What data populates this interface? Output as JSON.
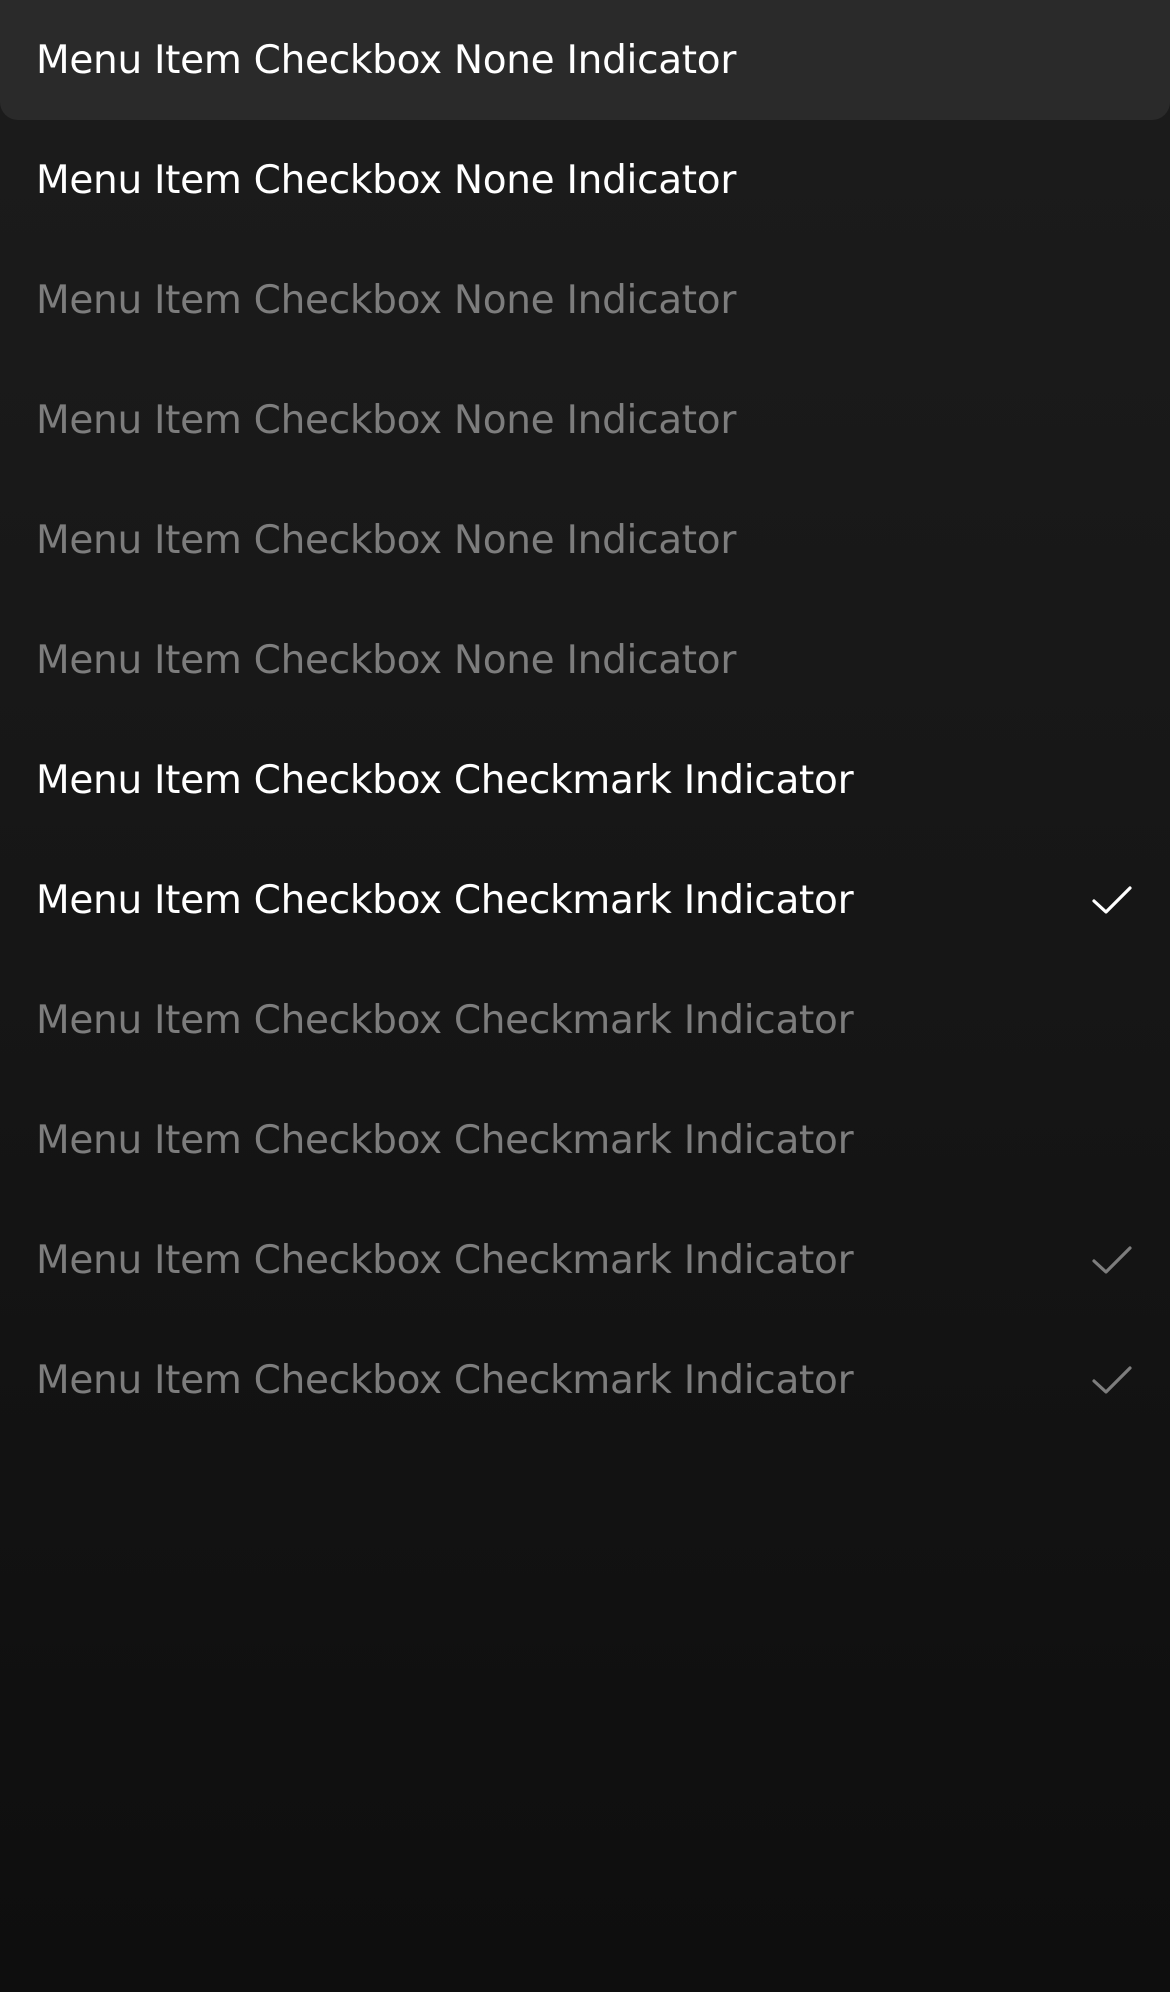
{
  "colors": {
    "background": "#1a1a1a",
    "highlight": "#2a2a2a",
    "text_primary": "#ffffff",
    "text_muted": "#7d7d7d"
  },
  "menu": {
    "items": [
      {
        "label": "Menu Item Checkbox None Indicator",
        "style": "primary",
        "highlighted": true,
        "checked": false,
        "icon": ""
      },
      {
        "label": "Menu Item Checkbox None Indicator",
        "style": "primary",
        "highlighted": false,
        "checked": false,
        "icon": ""
      },
      {
        "label": "Menu Item Checkbox None Indicator",
        "style": "muted",
        "highlighted": false,
        "checked": false,
        "icon": ""
      },
      {
        "label": "Menu Item Checkbox None Indicator",
        "style": "muted",
        "highlighted": false,
        "checked": false,
        "icon": ""
      },
      {
        "label": "Menu Item Checkbox None Indicator",
        "style": "muted",
        "highlighted": false,
        "checked": false,
        "icon": ""
      },
      {
        "label": "Menu Item Checkbox None Indicator",
        "style": "muted",
        "highlighted": false,
        "checked": false,
        "icon": ""
      },
      {
        "label": "Menu Item Checkbox Checkmark Indicator",
        "style": "primary",
        "highlighted": false,
        "checked": false,
        "icon": ""
      },
      {
        "label": "Menu Item Checkbox Checkmark Indicator",
        "style": "primary",
        "highlighted": false,
        "checked": true,
        "icon": "checkmark-icon"
      },
      {
        "label": "Menu Item Checkbox Checkmark Indicator",
        "style": "muted",
        "highlighted": false,
        "checked": false,
        "icon": ""
      },
      {
        "label": "Menu Item Checkbox Checkmark Indicator",
        "style": "muted",
        "highlighted": false,
        "checked": false,
        "icon": ""
      },
      {
        "label": "Menu Item Checkbox Checkmark Indicator",
        "style": "muted",
        "highlighted": false,
        "checked": true,
        "icon": "checkmark-icon"
      },
      {
        "label": "Menu Item Checkbox Checkmark Indicator",
        "style": "muted",
        "highlighted": false,
        "checked": true,
        "icon": "checkmark-icon"
      }
    ]
  }
}
